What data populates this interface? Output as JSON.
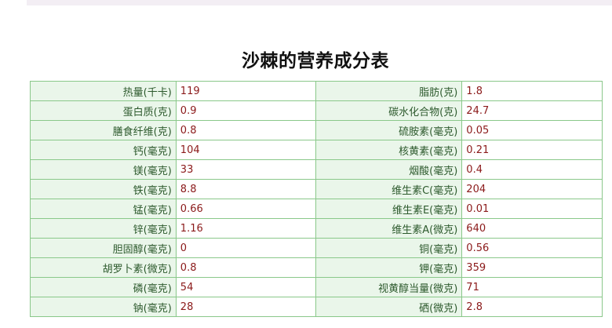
{
  "title": "沙棘的营养成分表",
  "rows": [
    [
      {
        "label": "热量(千卡)",
        "value": "119"
      },
      {
        "label": "脂肪(克)",
        "value": "1.8"
      }
    ],
    [
      {
        "label": "蛋白质(克)",
        "value": "0.9"
      },
      {
        "label": "碳水化合物(克)",
        "value": "24.7"
      }
    ],
    [
      {
        "label": "膳食纤维(克)",
        "value": "0.8"
      },
      {
        "label": "硫胺素(毫克)",
        "value": "0.05"
      }
    ],
    [
      {
        "label": "钙(毫克)",
        "value": "104"
      },
      {
        "label": "核黄素(毫克)",
        "value": "0.21"
      }
    ],
    [
      {
        "label": "镁(毫克)",
        "value": "33"
      },
      {
        "label": "烟酸(毫克)",
        "value": "0.4"
      }
    ],
    [
      {
        "label": "铁(毫克)",
        "value": "8.8"
      },
      {
        "label": "维生素C(毫克)",
        "value": "204"
      }
    ],
    [
      {
        "label": "锰(毫克)",
        "value": "0.66"
      },
      {
        "label": "维生素E(毫克)",
        "value": "0.01"
      }
    ],
    [
      {
        "label": "锌(毫克)",
        "value": "1.16"
      },
      {
        "label": "维生素A(微克)",
        "value": "640"
      }
    ],
    [
      {
        "label": "胆固醇(毫克)",
        "value": "0"
      },
      {
        "label": "铜(毫克)",
        "value": "0.56"
      }
    ],
    [
      {
        "label": "胡罗卜素(微克)",
        "value": "0.8"
      },
      {
        "label": "钾(毫克)",
        "value": "359"
      }
    ],
    [
      {
        "label": "磷(毫克)",
        "value": "54"
      },
      {
        "label": "视黄醇当量(微克)",
        "value": "71"
      }
    ],
    [
      {
        "label": "钠(毫克)",
        "value": "28"
      },
      {
        "label": "硒(微克)",
        "value": "2.8"
      }
    ]
  ]
}
